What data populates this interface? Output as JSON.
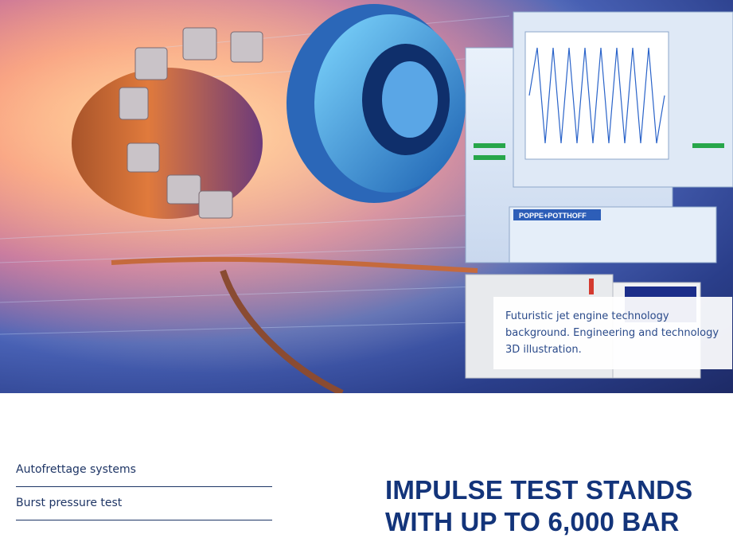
{
  "hero": {
    "image_description_label": "jet-engine-hero-image",
    "caption": "Futuristic jet engine technology background. Engineering and technology 3D illustration.",
    "screen_brand": "POPPE+POTTHOFF"
  },
  "sidebar": {
    "items": [
      {
        "label": "Autofrettage systems"
      },
      {
        "label": "Burst pressure test"
      }
    ]
  },
  "main": {
    "headline_line1": "IMPULSE TEST STANDS",
    "headline_line2": "WITH UP TO 6,000 BAR"
  },
  "colors": {
    "navy": "#13347a",
    "link": "#1e3565",
    "caption_text": "#2a4a8a"
  }
}
